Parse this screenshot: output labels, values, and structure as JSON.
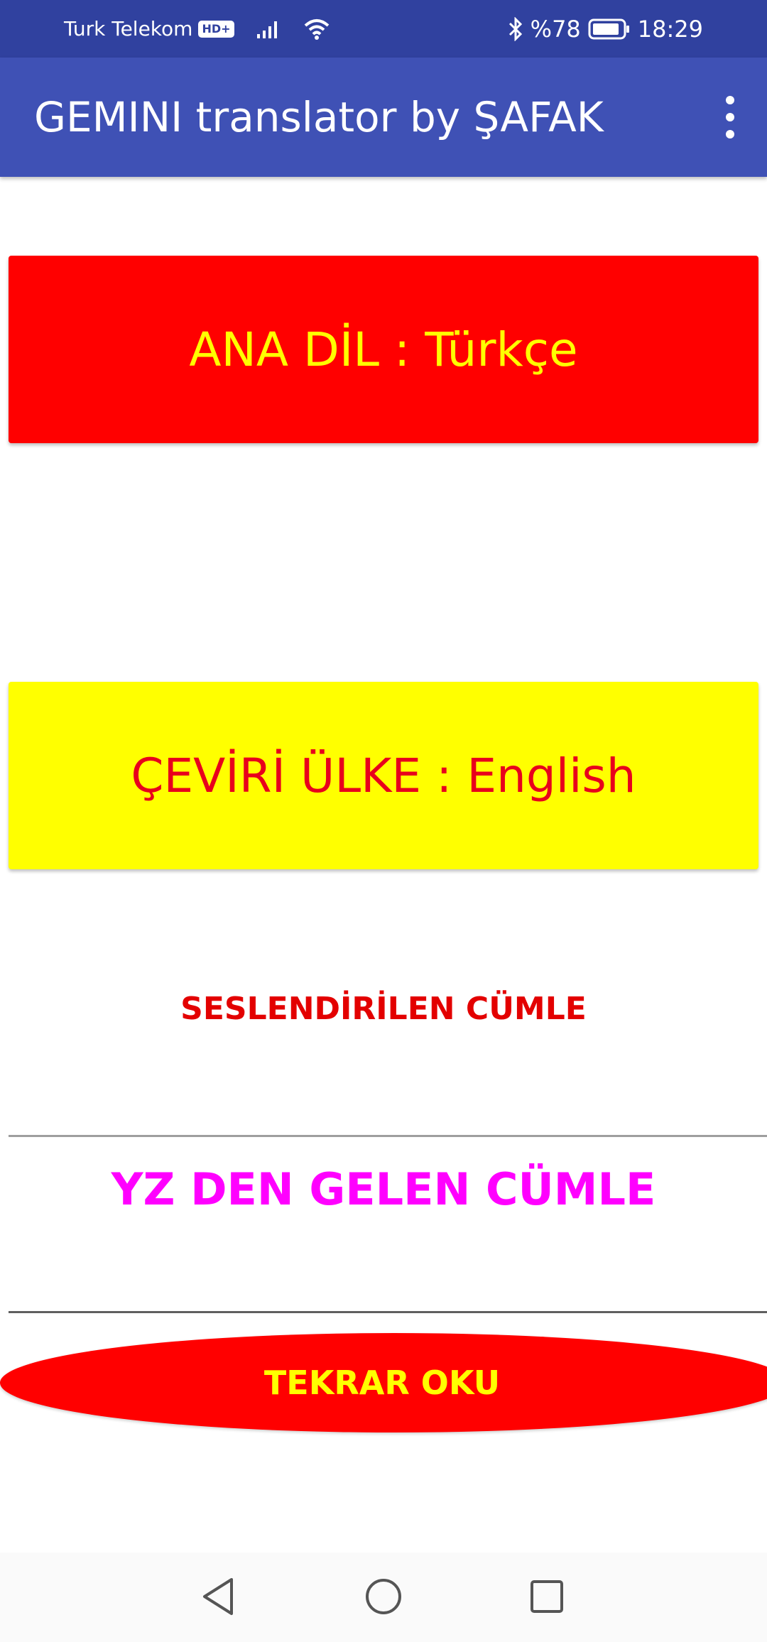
{
  "status_bar": {
    "carrier": "Turk Telekom",
    "hd_badge": "HD+",
    "battery": "%78",
    "time": "18:29",
    "icons": [
      "signal-icon",
      "wifi-icon",
      "bluetooth-icon",
      "battery-icon"
    ]
  },
  "app_bar": {
    "title": "GEMINI translator by ŞAFAK",
    "menu_icon": "more-vert-icon"
  },
  "main": {
    "primary_language_label": "ANA DİL : Türkçe",
    "target_language_label": "ÇEVİRİ ÜLKE : English",
    "spoken_sentence": "SESLENDİRİLEN CÜMLE",
    "ai_sentence": "YZ DEN GELEN CÜMLE",
    "reread_label": "TEKRAR OKU"
  },
  "colors": {
    "status_bar": "#30419f",
    "app_bar": "#3f51b5",
    "red": "#ff0000",
    "yellow": "#ffff00",
    "magenta": "#ff00ff"
  },
  "nav_bar": {
    "icons": [
      "back-icon",
      "home-icon",
      "recents-icon"
    ]
  }
}
